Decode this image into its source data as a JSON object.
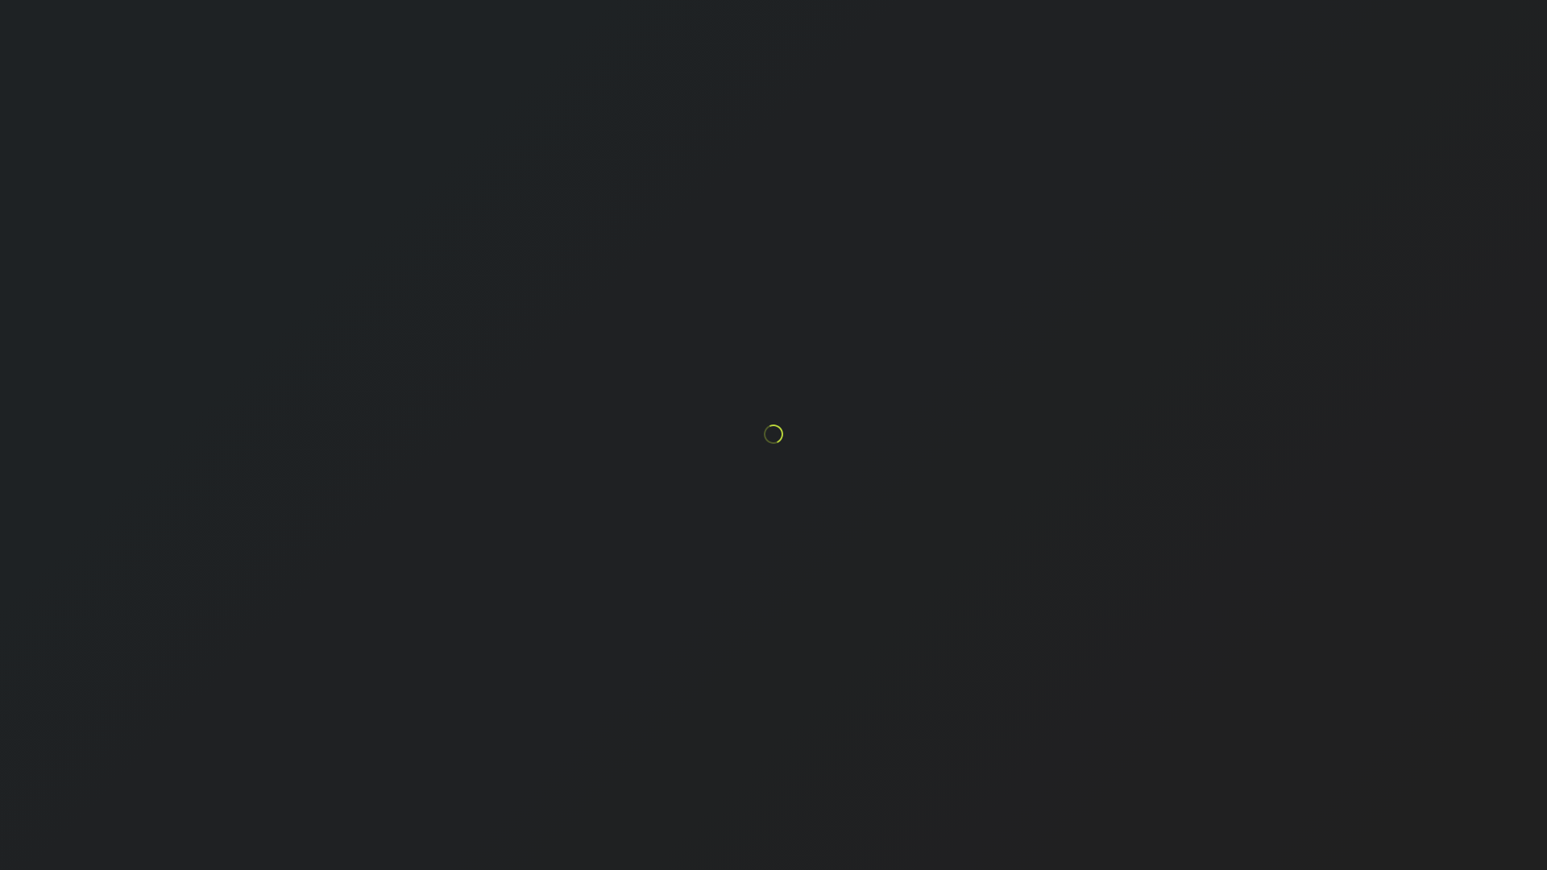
{
  "screen": {
    "state": "loading"
  },
  "spinner": {
    "icon": "loading-spinner-icon",
    "accent_color": "#b8d43a",
    "track_color": "#4f5a2a"
  },
  "colors": {
    "background": "#1f2123"
  }
}
